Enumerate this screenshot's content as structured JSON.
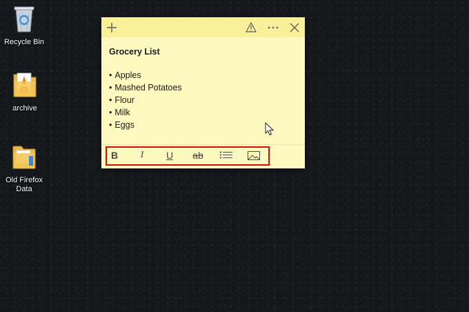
{
  "desktop": {
    "icons": [
      {
        "label": "Recycle Bin",
        "icon": "recycle-bin-icon"
      },
      {
        "label": "archive",
        "icon": "media-folder-icon"
      },
      {
        "label": "Old Firefox Data",
        "icon": "folder-icon"
      }
    ]
  },
  "note": {
    "header": {
      "add_icon": "plus-icon",
      "warning_icon": "warning-icon",
      "menu_icon": "more-icon",
      "close_icon": "close-icon"
    },
    "title": "Grocery List",
    "items": [
      "Apples",
      "Mashed Potatoes",
      "Flour",
      "Milk",
      "Eggs"
    ],
    "toolbar": {
      "bold": "B",
      "italic": "I",
      "underline": "U",
      "strikethrough": "ab",
      "list_icon": "bullet-list-icon",
      "image_icon": "image-icon"
    },
    "colors": {
      "body": "#fef9be",
      "header": "#fbf09a",
      "highlight": "#d60d0d"
    }
  }
}
